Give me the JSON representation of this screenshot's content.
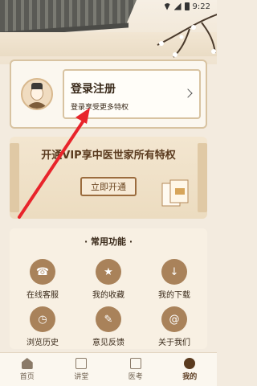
{
  "status_bar": {
    "time": "9:22"
  },
  "login": {
    "title": "登录注册",
    "subtitle": "登录享受更多特权"
  },
  "vip": {
    "title": "开通VIP享中医世家所有特权",
    "button": "立即开通"
  },
  "functions": {
    "title": "· 常用功能 ·",
    "items": [
      {
        "label": "在线客服",
        "icon": "headset-icon"
      },
      {
        "label": "我的收藏",
        "icon": "star-icon"
      },
      {
        "label": "我的下载",
        "icon": "download-icon"
      },
      {
        "label": "浏览历史",
        "icon": "clock-icon"
      },
      {
        "label": "意见反馈",
        "icon": "feedback-icon"
      },
      {
        "label": "关于我们",
        "icon": "info-icon"
      }
    ]
  },
  "nav": {
    "items": [
      {
        "label": "首页",
        "icon": "home-icon"
      },
      {
        "label": "讲堂",
        "icon": "hall-icon"
      },
      {
        "label": "医考",
        "icon": "exam-icon"
      },
      {
        "label": "我的",
        "icon": "profile-icon"
      }
    ]
  },
  "colors": {
    "accent": "#5a3a1e",
    "annotation": "#e8242b"
  }
}
